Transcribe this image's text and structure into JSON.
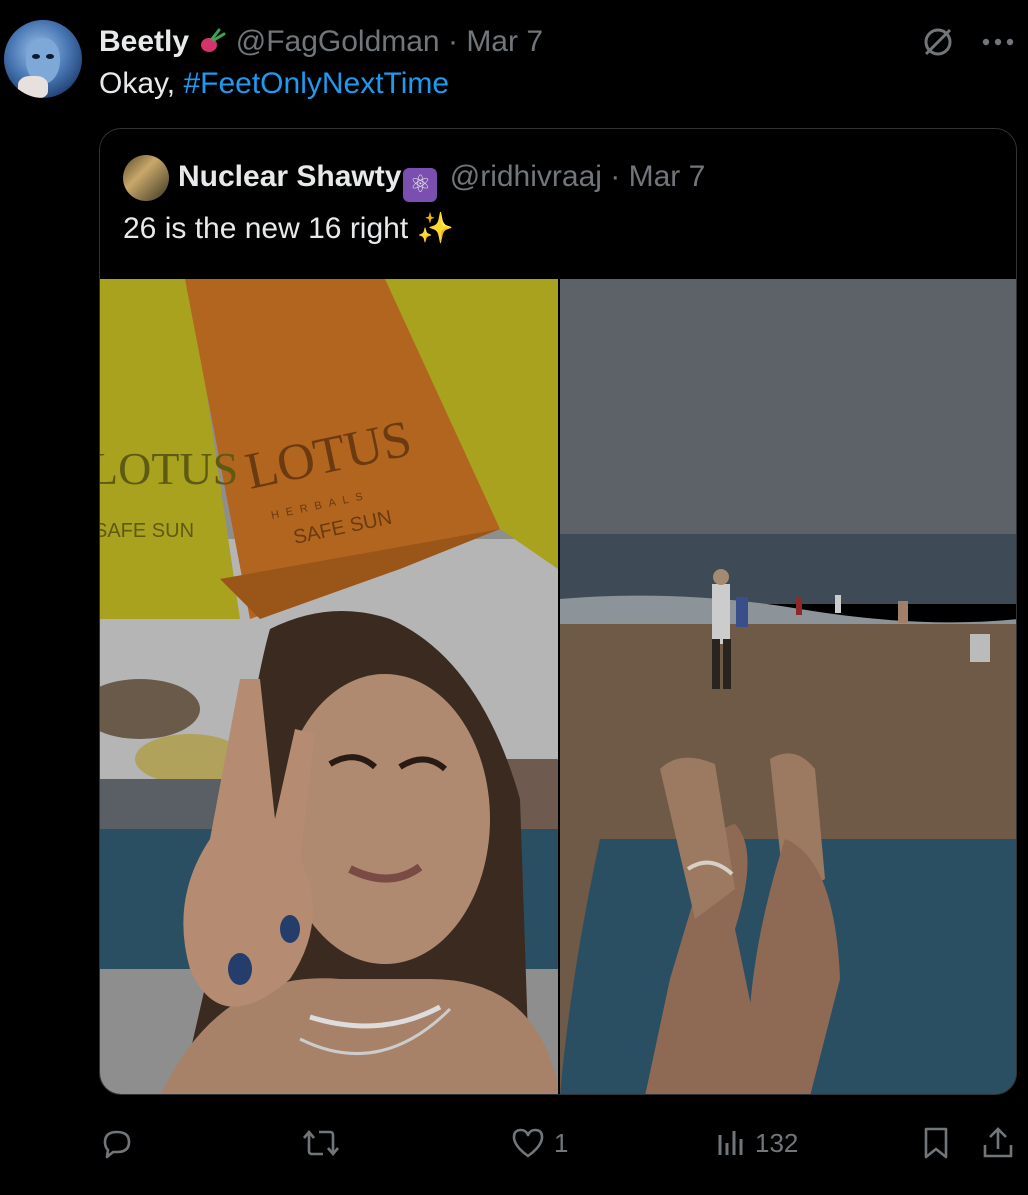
{
  "tweet": {
    "author_name": "Beetly",
    "author_handle": "@FagGoldman",
    "separator": "·",
    "date": "Mar 7",
    "text_prefix": "Okay, ",
    "hashtag": "#FeetOnlyNextTime"
  },
  "quoted": {
    "author_name": "Nuclear Shawty",
    "author_badge": "⚛",
    "author_handle": "@ridhivraaj",
    "separator": "·",
    "date": "Mar 7",
    "text": "26 is the new 16 right",
    "text_emoji": "✨",
    "umbrella_brand": "LOTUS",
    "umbrella_sub": "HERBALS",
    "umbrella_slogan": "SAFE SUN"
  },
  "actions": {
    "reply_count": "",
    "retweet_count": "",
    "like_count": "1",
    "views_count": "132"
  },
  "icons": {
    "grok": "slashed-circle-icon",
    "more": "more-icon",
    "reply": "reply-icon",
    "retweet": "retweet-icon",
    "like": "heart-icon",
    "views": "views-icon",
    "bookmark": "bookmark-icon",
    "share": "share-icon"
  },
  "colors": {
    "background": "#000000",
    "text": "#e7e9ea",
    "muted": "#71767b",
    "link": "#1d9bf0",
    "border": "#2f3336"
  }
}
